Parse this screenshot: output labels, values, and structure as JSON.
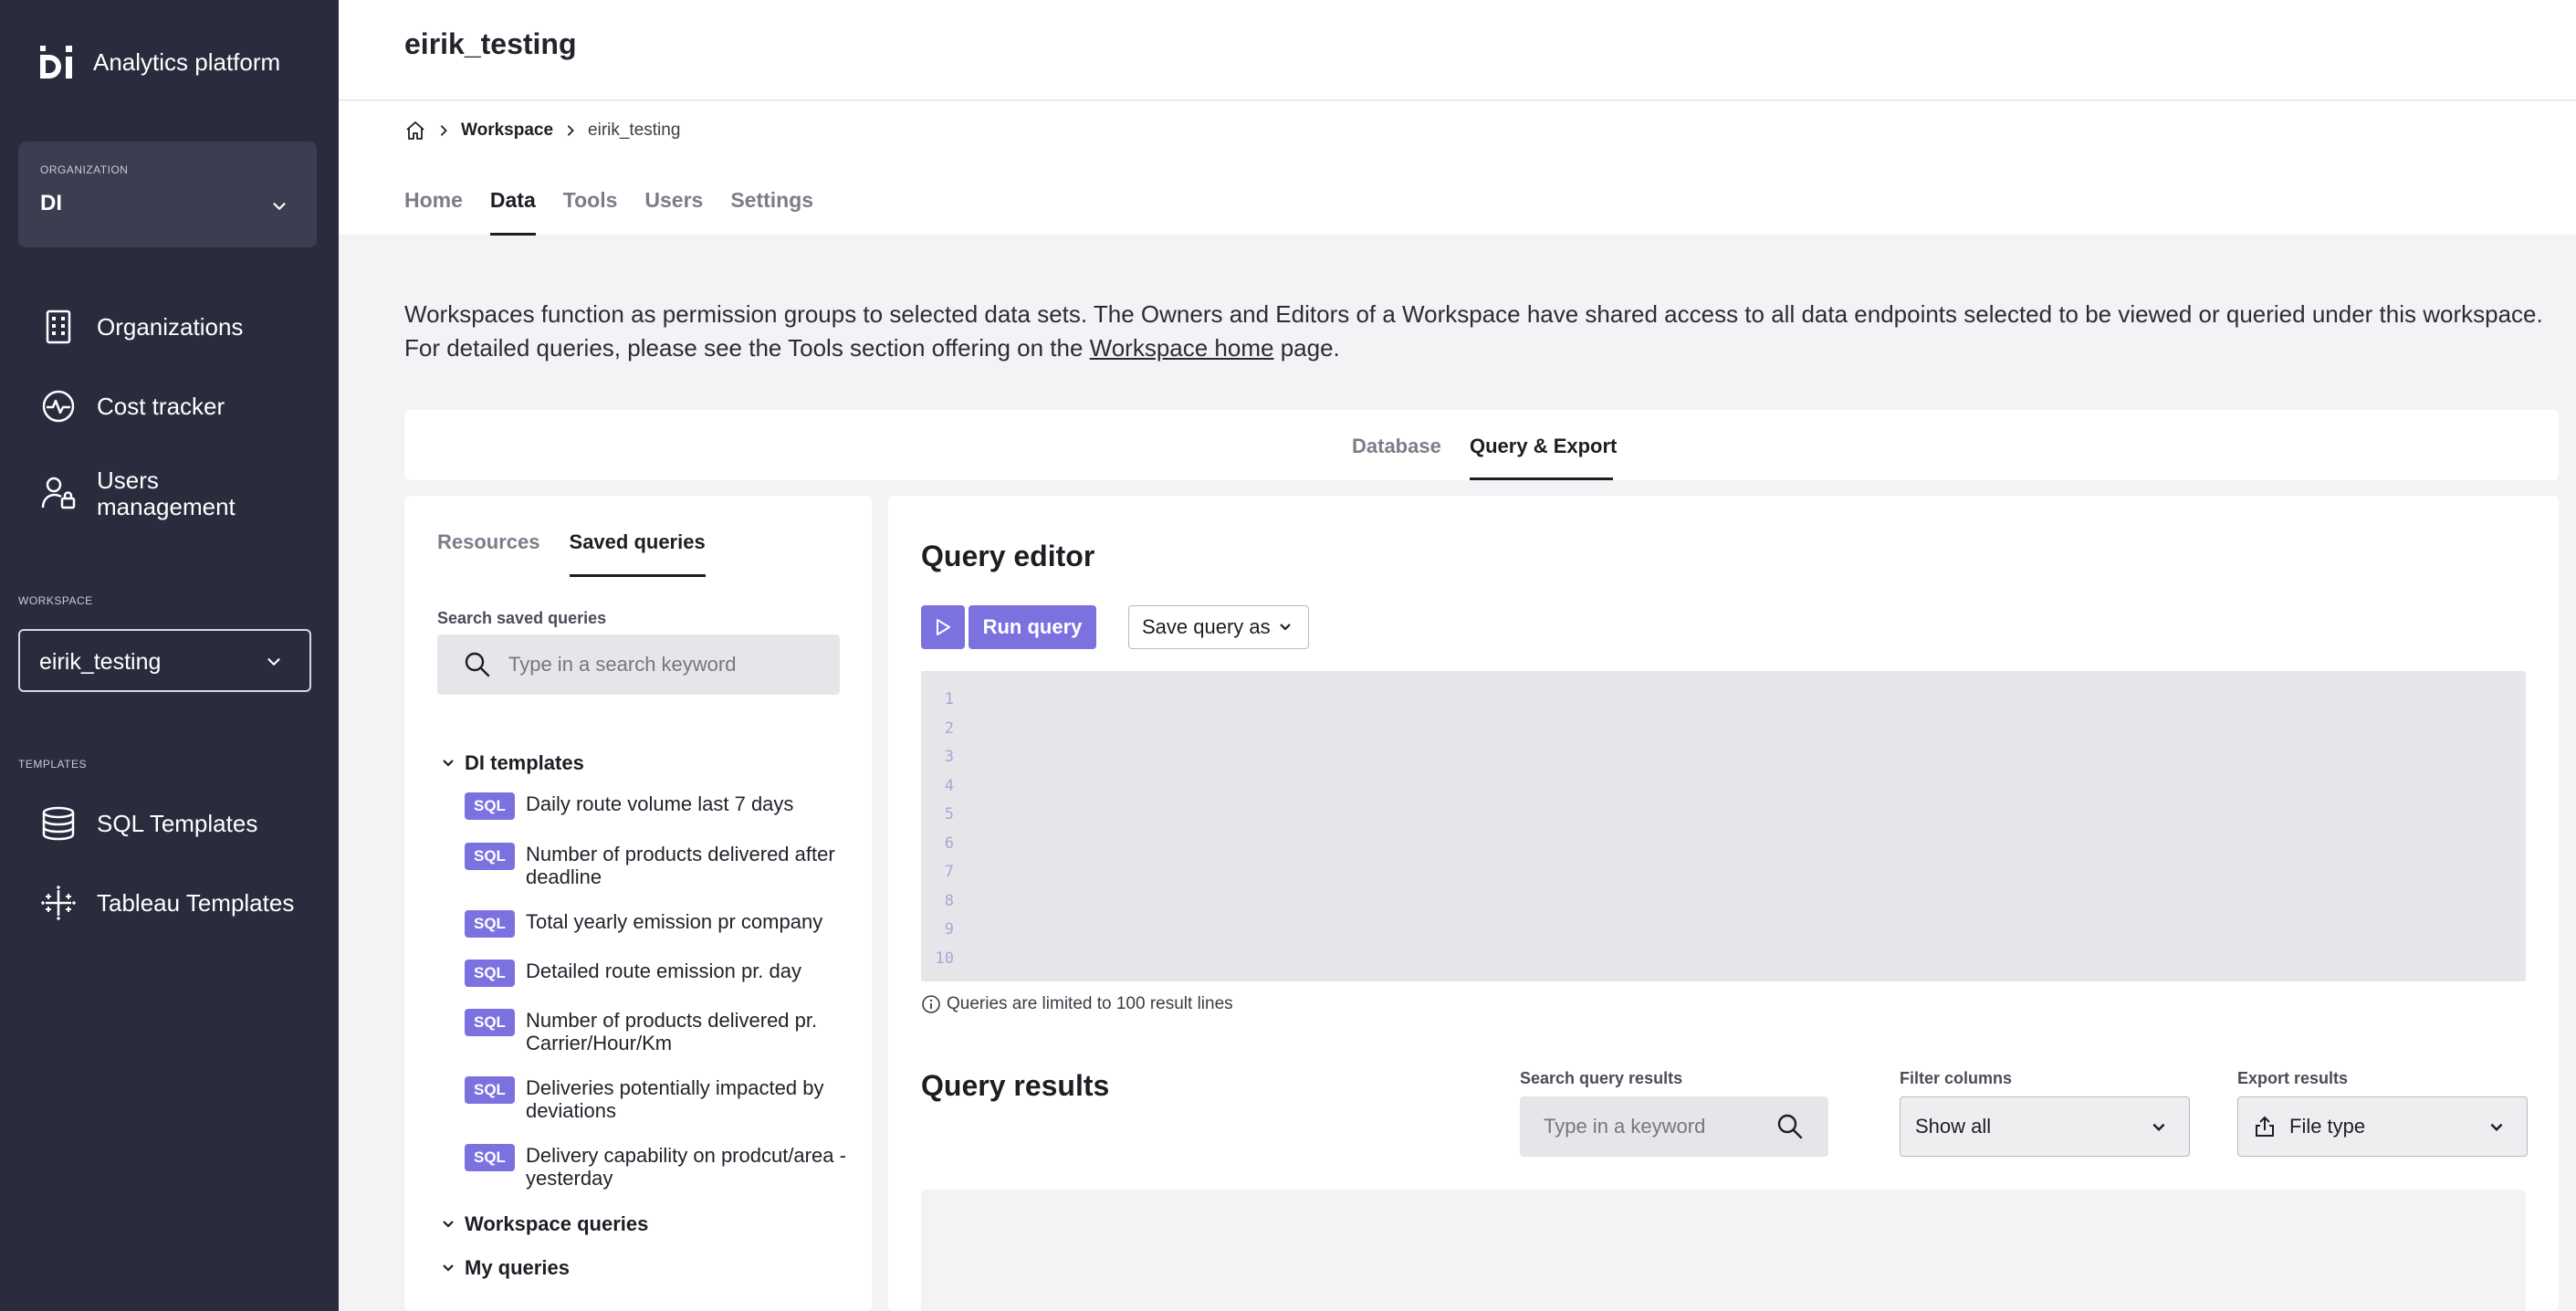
{
  "app": {
    "title": "Analytics platform",
    "accent_color": "#7b72e0",
    "sidebar_color": "#282c3d"
  },
  "sidebar": {
    "organization": {
      "label": "ORGANIZATION",
      "value": "DI"
    },
    "nav": [
      {
        "label": "Organizations",
        "icon": "building-icon"
      },
      {
        "label": "Cost tracker",
        "icon": "activity-icon"
      },
      {
        "label": "Users management",
        "icon": "user-lock-icon"
      }
    ],
    "workspace": {
      "label": "WORKSPACE",
      "value": "eirik_testing"
    },
    "templates": {
      "label": "TEMPLATES",
      "items": [
        {
          "label": "SQL Templates",
          "icon": "database-icon"
        },
        {
          "label": "Tableau Templates",
          "icon": "tableau-icon"
        }
      ]
    }
  },
  "header": {
    "title": "eirik_testing",
    "breadcrumb": {
      "workspace": "Workspace",
      "current": "eirik_testing"
    },
    "tabs": [
      "Home",
      "Data",
      "Tools",
      "Users",
      "Settings"
    ],
    "active_tab": "Data"
  },
  "intro": {
    "text_before": "Workspaces function as permission groups to selected data sets. The Owners and Editors of a Workspace have shared access to all data endpoints selected to be viewed or queried under this workspace. For detailed queries, please see the Tools section offering on the ",
    "link": "Workspace home",
    "text_after": " page."
  },
  "segments": {
    "items": [
      "Database",
      "Query & Export"
    ],
    "active": "Query & Export"
  },
  "left_panel": {
    "tabs": [
      "Resources",
      "Saved queries"
    ],
    "active_tab": "Saved queries",
    "search": {
      "label": "Search saved queries",
      "placeholder": "Type in a search keyword"
    },
    "groups": [
      {
        "title": "DI templates",
        "items": [
          {
            "badge": "SQL",
            "label": "Daily route volume last 7 days"
          },
          {
            "badge": "SQL",
            "label": "Number of products delivered after deadline"
          },
          {
            "badge": "SQL",
            "label": "Total yearly emission pr company"
          },
          {
            "badge": "SQL",
            "label": "Detailed route emission pr. day"
          },
          {
            "badge": "SQL",
            "label": "Number of products delivered pr. Carrier/Hour/Km"
          },
          {
            "badge": "SQL",
            "label": "Deliveries potentially impacted by deviations"
          },
          {
            "badge": "SQL",
            "label": "Delivery capability on prodcut/area - yesterday"
          }
        ]
      },
      {
        "title": "Workspace queries"
      },
      {
        "title": "My queries"
      }
    ]
  },
  "editor": {
    "title": "Query editor",
    "run_label": "Run query",
    "save_label": "Save query as",
    "line_numbers": "1\n2\n3\n4\n5\n6\n7\n8\n9\n10",
    "limit_note": "Queries are limited to 100 result lines"
  },
  "results": {
    "title": "Query results",
    "search": {
      "label": "Search query results",
      "placeholder": "Type in a keyword"
    },
    "filter": {
      "label": "Filter columns",
      "value": "Show all"
    },
    "export": {
      "label": "Export results",
      "value": "File type"
    }
  }
}
